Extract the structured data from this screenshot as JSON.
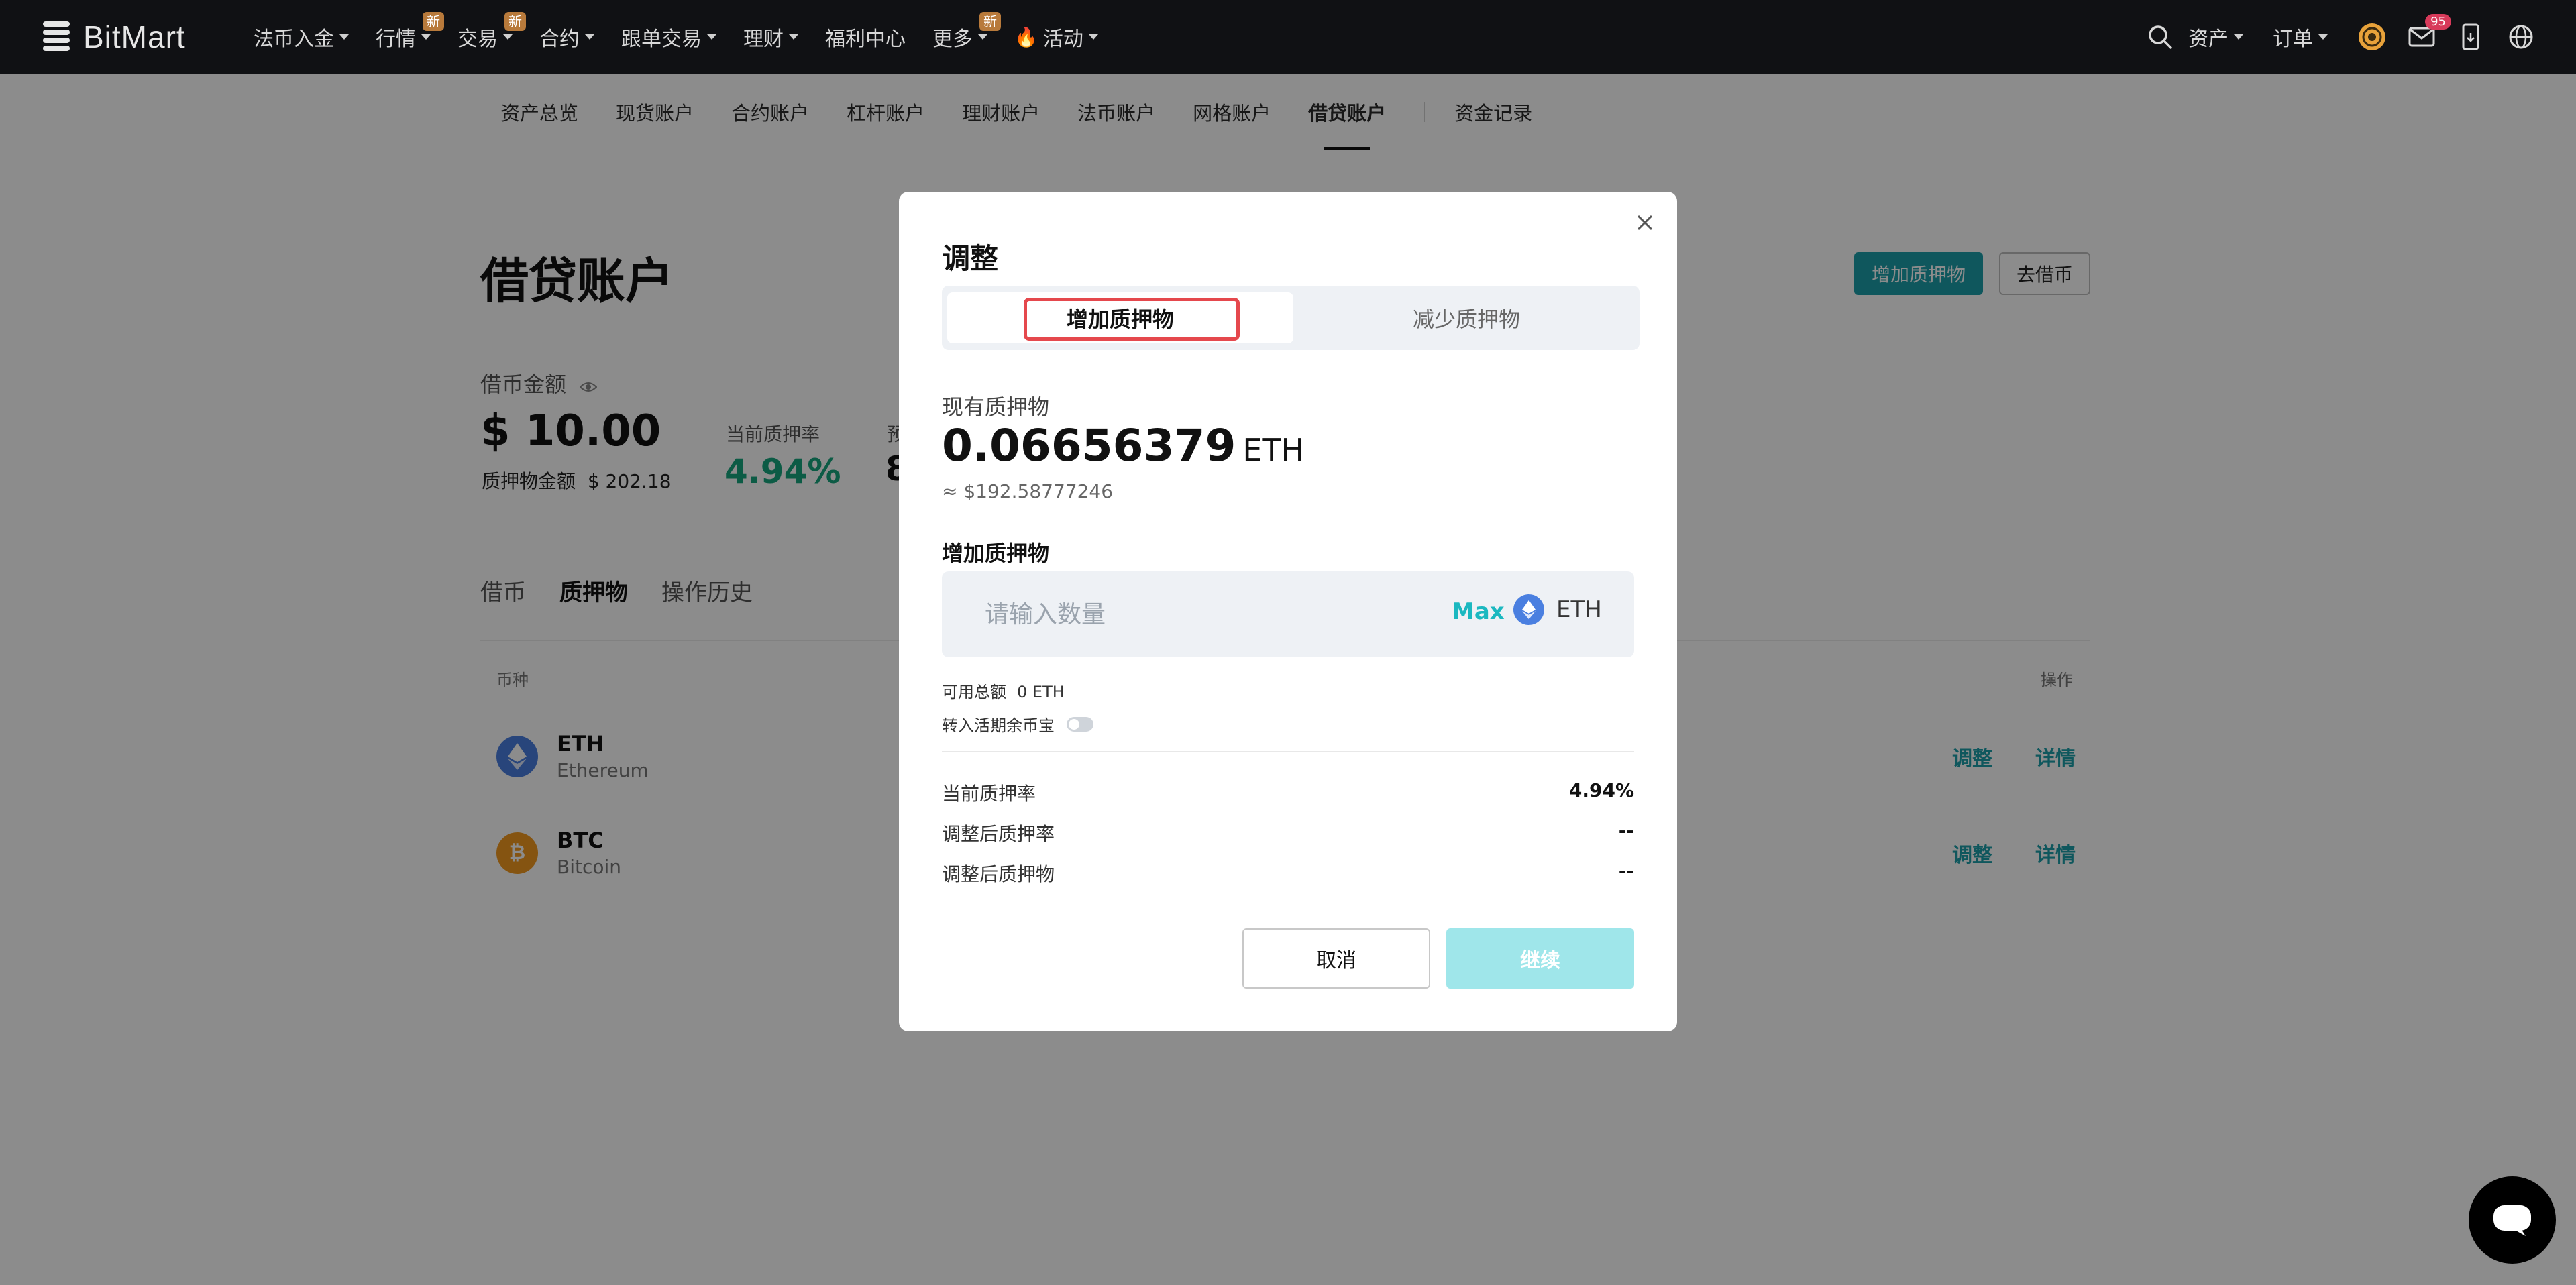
{
  "brand": {
    "name": "BitMart"
  },
  "topnav": {
    "items": [
      {
        "label": "法币入金",
        "caret": true
      },
      {
        "label": "行情",
        "caret": true,
        "badge": "新"
      },
      {
        "label": "交易",
        "caret": true,
        "badge": "新"
      },
      {
        "label": "合约",
        "caret": true
      },
      {
        "label": "跟单交易",
        "caret": true
      },
      {
        "label": "理财",
        "caret": true
      },
      {
        "label": "福利中心",
        "caret": false
      },
      {
        "label": "更多",
        "caret": true,
        "badge": "新"
      },
      {
        "label": "活动",
        "caret": true,
        "icon": "fire-icon"
      }
    ],
    "right": {
      "assets": "资产",
      "orders": "订单",
      "mail_count": "95"
    }
  },
  "subnav": {
    "tabs": [
      "资产总览",
      "现货账户",
      "合约账户",
      "杠杆账户",
      "理财账户",
      "法币账户",
      "网格账户",
      "借贷账户"
    ],
    "active": "借贷账户",
    "records": "资金记录"
  },
  "page": {
    "title": "借贷账户",
    "add_collateral_btn": "增加质押物",
    "borrow_btn": "去借币",
    "borrow_amount_label": "借币金额",
    "borrow_amount_value": "$ 10.00",
    "collateral_amount_label": "质押物金额",
    "collateral_amount_value": "$ 202.18",
    "current_rate_label": "当前质押率",
    "current_rate_value": "4.94%",
    "partial_label": "预",
    "partial_value": "8",
    "tabs": [
      "借币",
      "质押物",
      "操作历史"
    ],
    "active_tab": "质押物",
    "table": {
      "col_coin": "币种",
      "col_action": "操作",
      "rows": [
        {
          "symbol": "ETH",
          "name": "Ethereum",
          "adjust": "调整",
          "detail": "详情",
          "color": "#4a7fe0"
        },
        {
          "symbol": "BTC",
          "name": "Bitcoin",
          "adjust": "调整",
          "detail": "详情",
          "color": "#f29a1f"
        }
      ]
    }
  },
  "modal": {
    "title": "调整",
    "seg_add": "增加质押物",
    "seg_reduce": "减少质押物",
    "existing_label": "现有质押物",
    "existing_amount": "0.06656379",
    "existing_unit": "ETH",
    "existing_usd": "≈ $192.58777246",
    "add_label": "增加质押物",
    "input_placeholder": "请输入数量",
    "max_label": "Max",
    "input_coin": "ETH",
    "available_label": "可用总额",
    "available_value": "0 ETH",
    "transfer_label": "转入活期余币宝",
    "rows": [
      {
        "label": "当前质押率",
        "value": "4.94%"
      },
      {
        "label": "调整后质押率",
        "value": "--"
      },
      {
        "label": "调整后质押物",
        "value": "--"
      }
    ],
    "cancel": "取消",
    "continue": "继续"
  }
}
